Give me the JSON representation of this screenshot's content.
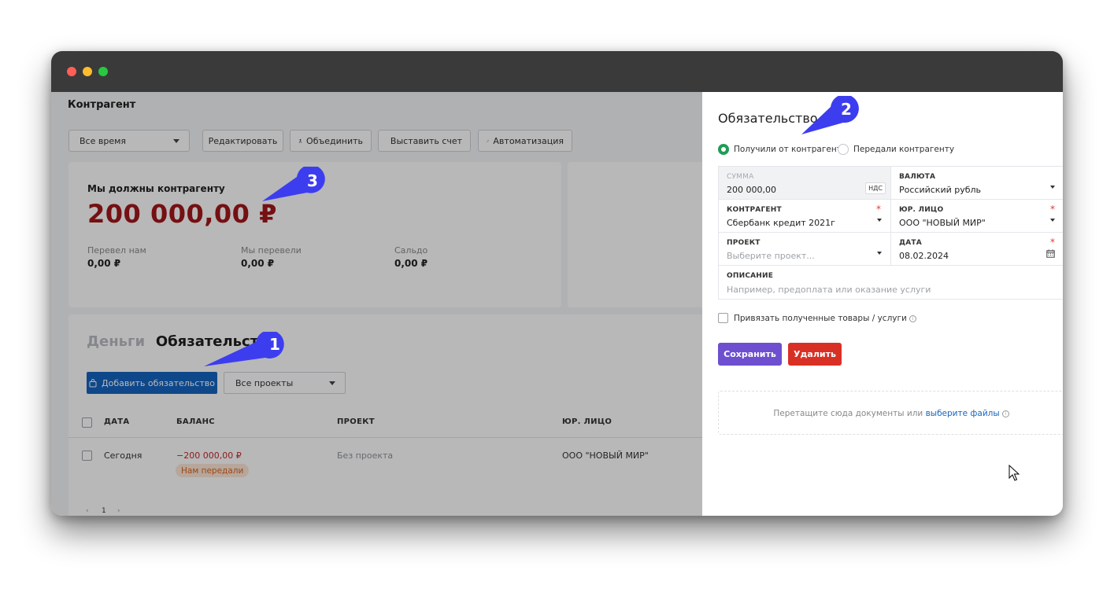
{
  "page": {
    "title": "Контрагент"
  },
  "toolbar": {
    "period_select": "Все время",
    "edit": "Редактировать",
    "merge": "Объединить",
    "invoice": "Выставить счет",
    "automation": "Автоматизация"
  },
  "summary": {
    "label": "Мы должны контрагенту",
    "amount": "200 000,00 ₽",
    "stats": [
      {
        "label": "Перевел нам",
        "value": "0,00 ₽"
      },
      {
        "label": "Мы перевели",
        "value": "0,00 ₽"
      },
      {
        "label": "Сальдо",
        "value": "0,00 ₽"
      }
    ]
  },
  "section": {
    "tab_money": "Деньги",
    "tab_obligations": "Обязательства",
    "add_button": "Добавить обязательство",
    "projects_select": "Все проекты"
  },
  "table": {
    "columns": [
      "ДАТА",
      "БАЛАНС",
      "ПРОЕКТ",
      "ЮР. ЛИЦО"
    ],
    "rows": [
      {
        "date": "Сегодня",
        "balance": "−200 000,00 ₽",
        "badge": "Нам передали",
        "project": "Без проекта",
        "entity": "ООО \"НОВЫЙ МИР\""
      }
    ],
    "pager": {
      "prev": "‹",
      "page": "1",
      "next": "›"
    }
  },
  "panel": {
    "title": "Обязательство",
    "radio_received": "Получили от контрагента",
    "radio_transferred": "Передали контрагенту",
    "fields": {
      "sum_label": "СУММА",
      "sum_value": "200 000,00",
      "vat": "НДС",
      "currency_label": "ВАЛЮТА",
      "currency_value": "Российский рубль",
      "counterparty_label": "КОНТРАГЕНТ",
      "counterparty_value": "Сбербанк кредит 2021г",
      "entity_label": "ЮР. ЛИЦО",
      "entity_value": "ООО \"НОВЫЙ МИР\"",
      "project_label": "ПРОЕКТ",
      "project_placeholder": "Выберите проект...",
      "date_label": "ДАТА",
      "date_value": "08.02.2024",
      "description_label": "ОПИСАНИЕ",
      "description_placeholder": "Например, предоплата или оказание услуги",
      "required_mark": "*"
    },
    "link_goods": "Привязать полученные товары / услуги",
    "save": "Сохранить",
    "delete": "Удалить",
    "dropzone_text": "Перетащите сюда документы или",
    "dropzone_link": "выберите файлы"
  },
  "callouts": [
    "1",
    "2",
    "3"
  ],
  "colors": {
    "accent_blue": "#1565c0",
    "callout": "#3d3df0",
    "debt_red": "#a3171b",
    "save_purple": "#6d4fcf",
    "delete_red": "#d93025",
    "radio_green": "#1f9d55"
  }
}
